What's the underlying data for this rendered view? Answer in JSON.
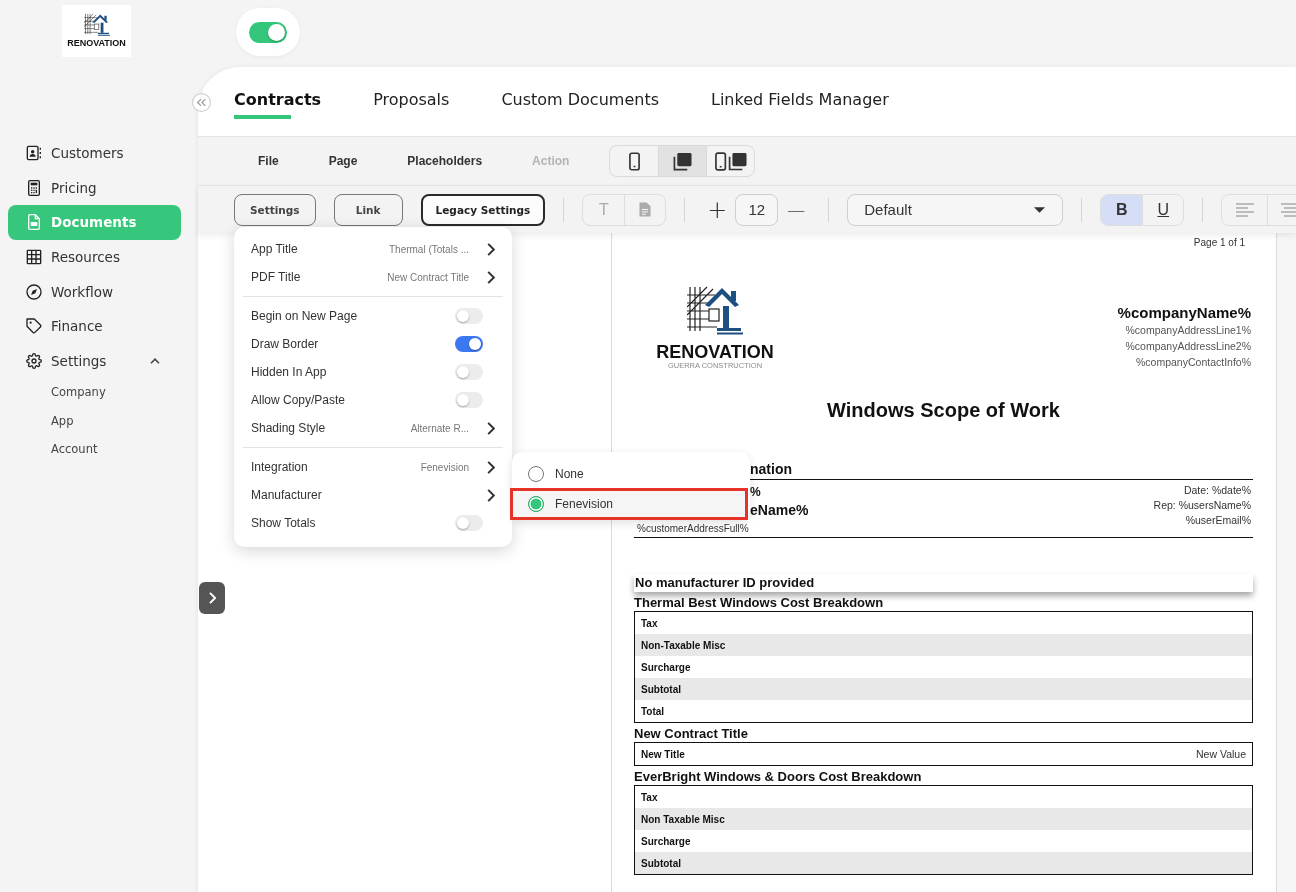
{
  "sidebar": {
    "logo": {
      "name": "RENOVATION"
    },
    "items": [
      {
        "label": "Customers",
        "selected": false
      },
      {
        "label": "Pricing",
        "selected": false
      },
      {
        "label": "Documents",
        "selected": true
      },
      {
        "label": "Resources",
        "selected": false
      },
      {
        "label": "Workflow",
        "selected": false
      },
      {
        "label": "Finance",
        "selected": false
      },
      {
        "label": "Settings",
        "selected": false,
        "expanded": true,
        "children": [
          {
            "label": "Company",
            "selected": false
          },
          {
            "label": "App",
            "selected": false
          },
          {
            "label": "Account",
            "selected": false
          }
        ]
      }
    ]
  },
  "header": {
    "toggle": {
      "on": true
    }
  },
  "tabs": [
    {
      "label": "Contracts",
      "selected": true
    },
    {
      "label": "Proposals",
      "selected": false
    },
    {
      "label": "Custom Documents",
      "selected": false
    },
    {
      "label": "Linked Fields Manager",
      "selected": false
    }
  ],
  "toolbar": {
    "menus": [
      {
        "label": "File",
        "disabled": false
      },
      {
        "label": "Page",
        "disabled": false
      },
      {
        "label": "Placeholders",
        "disabled": false
      },
      {
        "label": "Action",
        "disabled": true
      }
    ],
    "view_modes": [
      {
        "selected": false
      },
      {
        "selected": true
      },
      {
        "selected": false
      }
    ]
  },
  "format_bar": {
    "buttons": [
      {
        "label": "Settings",
        "focused": false
      },
      {
        "label": "Link",
        "focused": false
      },
      {
        "label": "Legacy Settings",
        "focused": true
      }
    ],
    "insert_buttons": [
      {
        "glyph": "T",
        "disabled": true
      },
      {
        "disabled": true
      }
    ],
    "size": {
      "increase": "+",
      "value": "12",
      "decrease": "—"
    },
    "font": {
      "value": "Default"
    },
    "style_buttons": [
      {
        "glyph": "B",
        "kind": "bold",
        "selected": true
      },
      {
        "glyph": "U",
        "kind": "underline",
        "selected": false
      }
    ],
    "align_buttons": [
      {
        "disabled": true
      },
      {
        "disabled": true
      }
    ]
  },
  "settings_menu": {
    "sections": [
      {
        "rows": [
          {
            "kind": "link",
            "label": "App Title",
            "value": "Thermal (Totals ..."
          },
          {
            "kind": "link",
            "label": "PDF Title",
            "value": "New Contract Title"
          }
        ]
      },
      {
        "rows": [
          {
            "kind": "toggle",
            "label": "Begin on New Page",
            "on": false
          },
          {
            "kind": "toggle",
            "label": "Draw Border",
            "on": true
          },
          {
            "kind": "toggle",
            "label": "Hidden In App",
            "on": false
          },
          {
            "kind": "toggle",
            "label": "Allow Copy/Paste",
            "on": false
          },
          {
            "kind": "link",
            "label": "Shading Style",
            "value": "Alternate R..."
          }
        ]
      },
      {
        "rows": [
          {
            "kind": "link",
            "label": "Integration",
            "value": "Fenevision"
          },
          {
            "kind": "link",
            "label": "Manufacturer"
          },
          {
            "kind": "toggle",
            "label": "Show Totals",
            "on": false
          }
        ]
      }
    ],
    "submenu": {
      "options": [
        {
          "label": "None",
          "selected": false,
          "marked": false
        },
        {
          "label": "Fenevision",
          "selected": true,
          "marked": true
        }
      ]
    }
  },
  "document": {
    "page_label": "Page 1 of 1",
    "logo": {
      "name": "RENOVATION",
      "tagline": "GUERRA CONSTRUCTION"
    },
    "company": {
      "name": "%companyName%",
      "lines": [
        "%companyAddressLine1%",
        "%companyAddressLine2%",
        "%companyContactInfo%"
      ]
    },
    "title": "Windows Scope of Work",
    "info": {
      "heading": {
        "text": "nation",
        "covered": true
      },
      "left": [
        {
          "text": "%",
          "kind": "strong",
          "covered": true
        },
        {
          "text": "eName%",
          "kind": "large",
          "covered": true
        },
        {
          "text": "%customerAddressFull%",
          "kind": "small",
          "covered": false
        }
      ],
      "right": [
        "Date: %date%",
        "Rep: %usersName%",
        "%userEmail%"
      ]
    },
    "notice": "No manufacturer ID provided",
    "sections": [
      {
        "title": "Thermal Best Windows Cost Breakdown",
        "rows": [
          {
            "label": "Tax",
            "shaded": false
          },
          {
            "label": "Non-Taxable Misc",
            "shaded": true
          },
          {
            "label": "Surcharge",
            "shaded": false
          },
          {
            "label": "Subtotal",
            "shaded": true
          },
          {
            "label": "Total",
            "shaded": false
          }
        ]
      },
      {
        "title": "New Contract Title",
        "rows": [
          {
            "label": "New Title",
            "value": "New Value",
            "shaded": false
          }
        ]
      },
      {
        "title": "EverBright Windows & Doors Cost Breakdown",
        "rows": [
          {
            "label": "Tax",
            "shaded": false
          },
          {
            "label": "Non Taxable Misc",
            "shaded": true
          },
          {
            "label": "Surcharge",
            "shaded": false
          },
          {
            "label": "Subtotal",
            "shaded": true
          }
        ]
      }
    ]
  }
}
